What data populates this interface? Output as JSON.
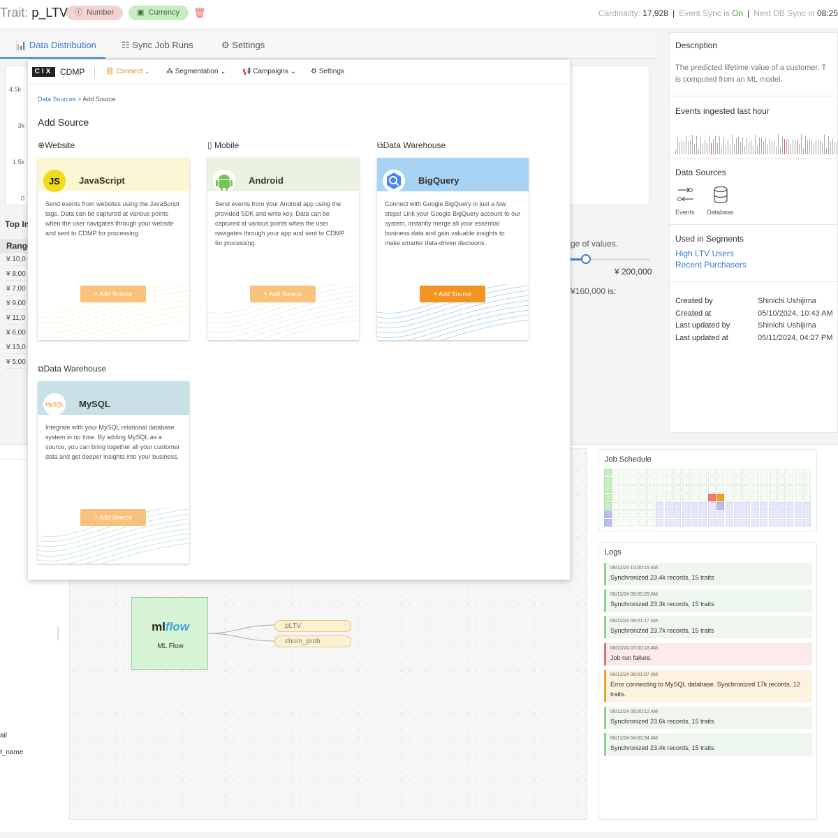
{
  "header": {
    "title_prefix": "Trait: ",
    "title_name": "p_LTV",
    "pill_number": "Number",
    "pill_currency": "Currency",
    "cardinality_label": "Cardinality:",
    "cardinality_value": "17,928",
    "event_sync_label": "Event Sync is",
    "event_sync_value": "On",
    "db_sync_label": "Next DB Sync in",
    "db_sync_value": "08:25"
  },
  "tabs": [
    {
      "label": "Data Distribution"
    },
    {
      "label": "Sync Job Runs"
    },
    {
      "label": "Settings"
    }
  ],
  "chart": {
    "y_ticks": [
      "4.5k",
      "3k",
      "1.5k",
      "0"
    ]
  },
  "left_partial": {
    "top_in": "Top In",
    "range_header": "Range",
    "ranges": [
      "¥ 10,0",
      "¥ 8,00",
      "¥ 7,00",
      "¥ 9,00",
      "¥ 11,0",
      "¥ 6,00",
      "¥ 13,0",
      "¥ 5,00"
    ],
    "range_hint": "ge of values.",
    "slider_max": "¥ 200,000",
    "value_text": "¥160,000 is:"
  },
  "right_panel": {
    "description_h": "Description",
    "description_l1": "The predicted lifetime value of a customer. T",
    "description_l2": "is computed from an ML model.",
    "events_h": "Events ingested last hour",
    "sources_h": "Data Sources",
    "sources": [
      {
        "label": "Events"
      },
      {
        "label": "Database"
      }
    ],
    "segments_h": "Used in Segments",
    "segments": [
      "High LTV Users",
      "Recent Purchasers"
    ],
    "meta": [
      {
        "k": "Created by",
        "v": "Shinichi Ushijima"
      },
      {
        "k": "Created at",
        "v": "05/10/2024, 10:43 AM"
      },
      {
        "k": "Last updated by",
        "v": "Shinichi Ushijima"
      },
      {
        "k": "Last updated at",
        "v": "05/11/2024, 04:27 PM"
      }
    ]
  },
  "pipeline": {
    "mlflow_logo_a": "ml",
    "mlflow_logo_b": "flow",
    "mlflow_label": "ML Flow",
    "outputs": [
      "pLTV",
      "churn_prob"
    ],
    "side_fields": [
      "ail",
      "t_name"
    ]
  },
  "job_schedule": {
    "title": "Job Schedule"
  },
  "logs": {
    "title": "Logs",
    "items": [
      {
        "ts": "06/11/24 10:00:15 AM",
        "msg": "Synchronized 23.4k records, 15 traits",
        "status": "ok"
      },
      {
        "ts": "06/11/24 09:00:25 AM",
        "msg": "Synchronized 23.3k records, 15 traits",
        "status": "ok"
      },
      {
        "ts": "06/11/24 08:01:17 AM",
        "msg": "Synchronized 23.7k records, 15 traits",
        "status": "ok"
      },
      {
        "ts": "06/11/24 07:00:18 AM",
        "msg": "Job run failure.",
        "status": "error"
      },
      {
        "ts": "06/11/24 06:01:07 AM",
        "msg": "Error connecting to MySQL database. Synchronized 17k records, 12 traits.",
        "status": "warning"
      },
      {
        "ts": "06/11/24 05:00:12 AM",
        "msg": "Synchronized 23.6k records, 15 traits",
        "status": "ok"
      },
      {
        "ts": "06/11/24 04:00:34 AM",
        "msg": "Synchronized 23.4k records, 15 traits",
        "status": "ok"
      }
    ]
  },
  "modal": {
    "logo": "CIX",
    "brand": "CDMP",
    "nav": [
      {
        "label": "Connect"
      },
      {
        "label": "Segmentation"
      },
      {
        "label": "Campaigns"
      },
      {
        "label": "Settings"
      }
    ],
    "crumb_link": "Data Sources",
    "crumb_current": "> Add Source",
    "title": "Add Source",
    "sections": [
      {
        "label": "Website"
      },
      {
        "label": "Mobile"
      },
      {
        "label": "Data Warehouse"
      },
      {
        "label": "Data Warehouse"
      }
    ],
    "cards": [
      {
        "name": "JavaScript",
        "icon_text": "JS",
        "desc": "Send events from websites using the JavaScript tags. Data can be captured at various points when the user navigates through your website and sent to CDMP for processing.",
        "button": "+ Add Source",
        "header_color": "#fbf6d4",
        "button_color": "#f9c27a"
      },
      {
        "name": "Android",
        "icon_text": "",
        "desc": "Send events from your Android app using the provided SDK and write key. Data can be captured at various points when the user navigates through your app and sent to CDMP for processing.",
        "button": "+ Add Source",
        "header_color": "#e9f3df",
        "button_color": "#f9c27a"
      },
      {
        "name": "BigQuery",
        "icon_text": "",
        "desc": "Connect with Google BigQuery in just a few steps! Link your Google BigQuery account to our system, instantly merge all your essential business data and gain valuable insights to make smarter data-driven decisions.",
        "button": "+ Add Source",
        "header_color": "#a9d3f5",
        "button_color": "#f39321"
      },
      {
        "name": "MySQL",
        "icon_text": "MySQL",
        "desc": "Integrate with your MySQL relational database system in no time. By adding MySQL as a source, you can bring together all your customer data and get deeper insights into your business.",
        "button": "+ Add Source",
        "header_color": "#c9e0e7",
        "button_color": "#f9c27a"
      }
    ]
  },
  "colors": {
    "accent_blue": "#3a7bd5",
    "accent_orange": "#f39321",
    "ok_green": "#8fd08f",
    "error_red": "#e07070",
    "warn_orange": "#f0a030"
  }
}
